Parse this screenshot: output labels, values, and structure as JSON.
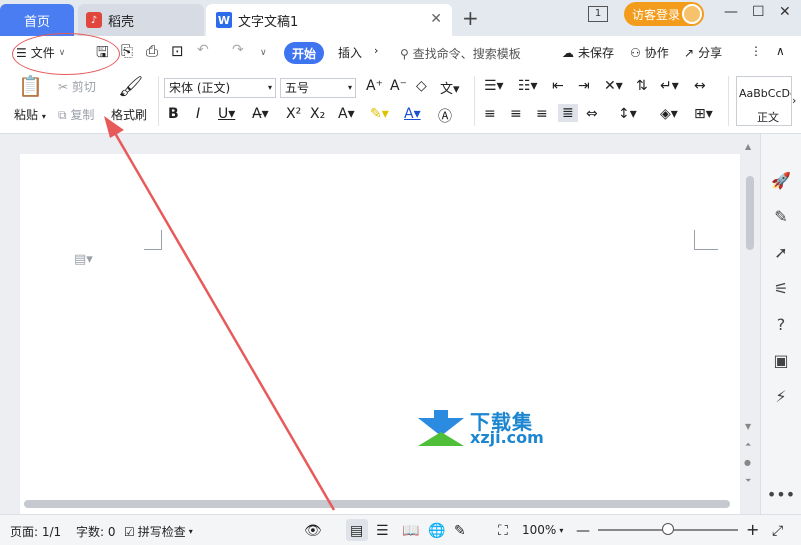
{
  "tabs": {
    "home": "首页",
    "daoke": "稻壳",
    "document": "文字文稿1"
  },
  "titlebar": {
    "window_count": "1",
    "login": "访客登录"
  },
  "menu": {
    "file": "文件",
    "start": "开始",
    "insert": "插入",
    "search_placeholder": "查找命令、搜索模板",
    "unsaved": "未保存",
    "collaborate": "协作",
    "share": "分享"
  },
  "ribbon": {
    "paste": "粘贴",
    "cut": "剪切",
    "copy": "复制",
    "format_painter": "格式刷",
    "font_name": "宋体 (正文)",
    "font_size": "五号",
    "style_sample": "AaBbCcDd",
    "style_name": "正文"
  },
  "watermark": {
    "line1": "下载集",
    "line2": "xzji.com"
  },
  "statusbar": {
    "page": "页面: 1/1",
    "words": "字数: 0",
    "spell_check": "拼写检查",
    "zoom": "100%"
  },
  "colors": {
    "accent": "#4a7df2",
    "login": "#f39c1b",
    "annotation": "#e85a5a"
  }
}
